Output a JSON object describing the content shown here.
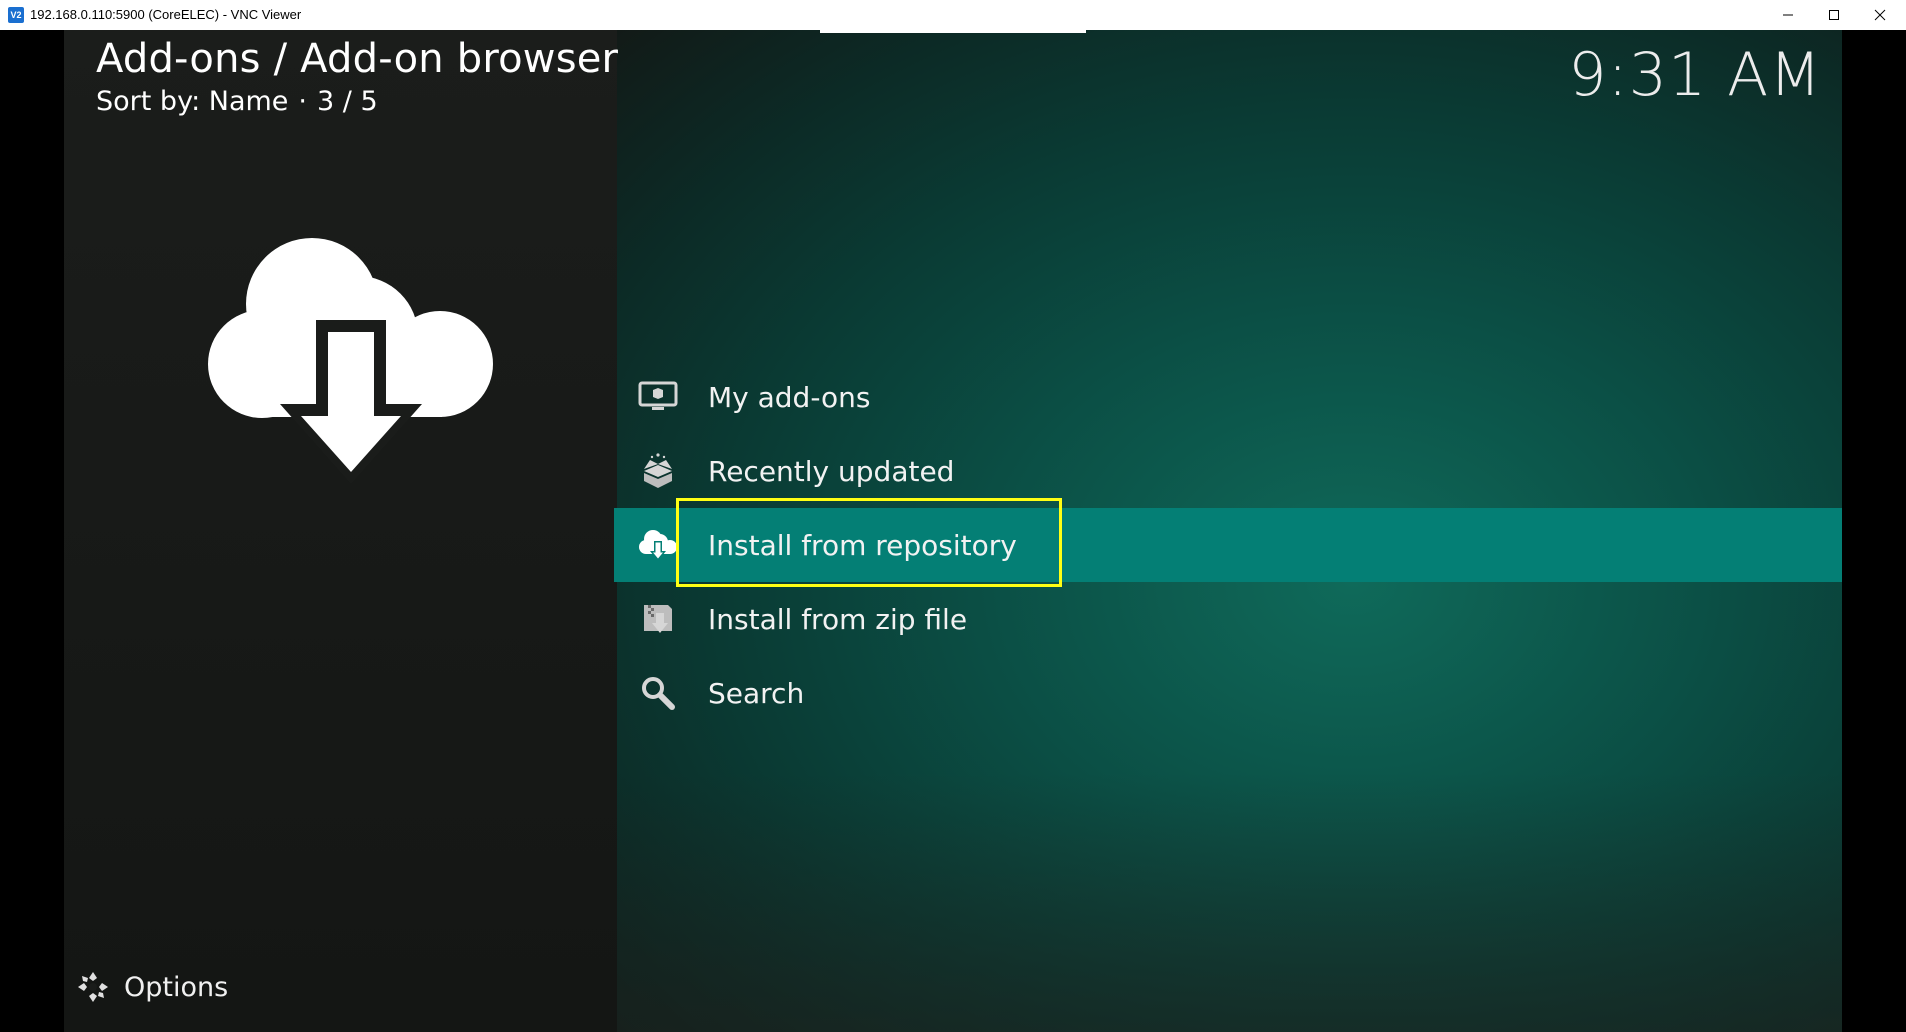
{
  "window": {
    "title": "192.168.0.110:5900 (CoreELEC) - VNC Viewer",
    "app_icon_text": "V2",
    "controls": [
      "minimize-icon",
      "maximize-icon",
      "close-icon"
    ]
  },
  "header": {
    "title": "Add-ons / Add-on browser",
    "sort_label": "Sort by: Name",
    "separator": "·",
    "position": "3 / 5"
  },
  "clock": "9:31 AM",
  "menu": {
    "items": [
      {
        "label": "My add-ons",
        "icon": "monitor-box-icon",
        "focused": false
      },
      {
        "label": "Recently updated",
        "icon": "open-box-icon",
        "focused": false
      },
      {
        "label": "Install from repository",
        "icon": "cloud-download-icon",
        "focused": true
      },
      {
        "label": "Install from zip file",
        "icon": "zip-download-icon",
        "focused": false
      },
      {
        "label": "Search",
        "icon": "search-icon",
        "focused": false
      }
    ]
  },
  "options_label": "Options",
  "colors": {
    "focus_bar": "#047f75",
    "highlight_box": "#ffff14",
    "text": "#ffffff"
  }
}
